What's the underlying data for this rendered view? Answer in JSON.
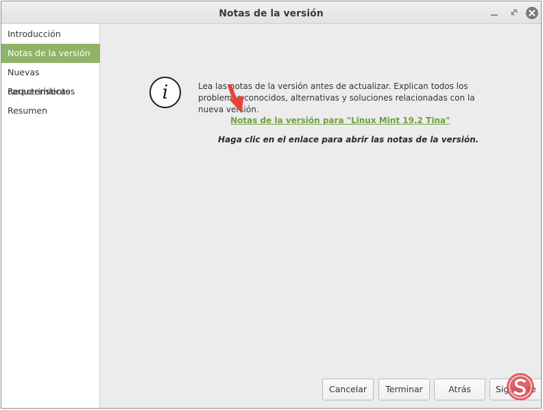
{
  "window": {
    "title": "Notas de la versión"
  },
  "sidebar": {
    "items": [
      {
        "label": "Introducción",
        "active": false
      },
      {
        "label": "Notas de la versión",
        "active": true
      },
      {
        "label": "Nuevas características",
        "active": false
      },
      {
        "label": "Requerimientos",
        "active": false
      },
      {
        "label": "Resumen",
        "active": false
      }
    ]
  },
  "content": {
    "description": "Lea las notas de la versión antes de actualizar. Explican todos los problemas conocidos, alternativas y soluciones relacionadas con la nueva versión.",
    "link_label": "Notas de la versión para \"Linux Mint 19.2 Tina\"",
    "hint": "Haga clic en el enlace para abrir las notas de la versión.",
    "info_glyph": "i"
  },
  "buttons": {
    "cancel": "Cancelar",
    "finish": "Terminar",
    "back": "Atrás",
    "next": "Siguiente"
  },
  "icons": {
    "info": "info-icon",
    "annotation": "arrow-icon",
    "watermark": "watermark-logo-icon"
  },
  "colors": {
    "accent_green": "#8fb367",
    "link_green": "#6f9e43",
    "arrow_red": "#e8433a"
  }
}
